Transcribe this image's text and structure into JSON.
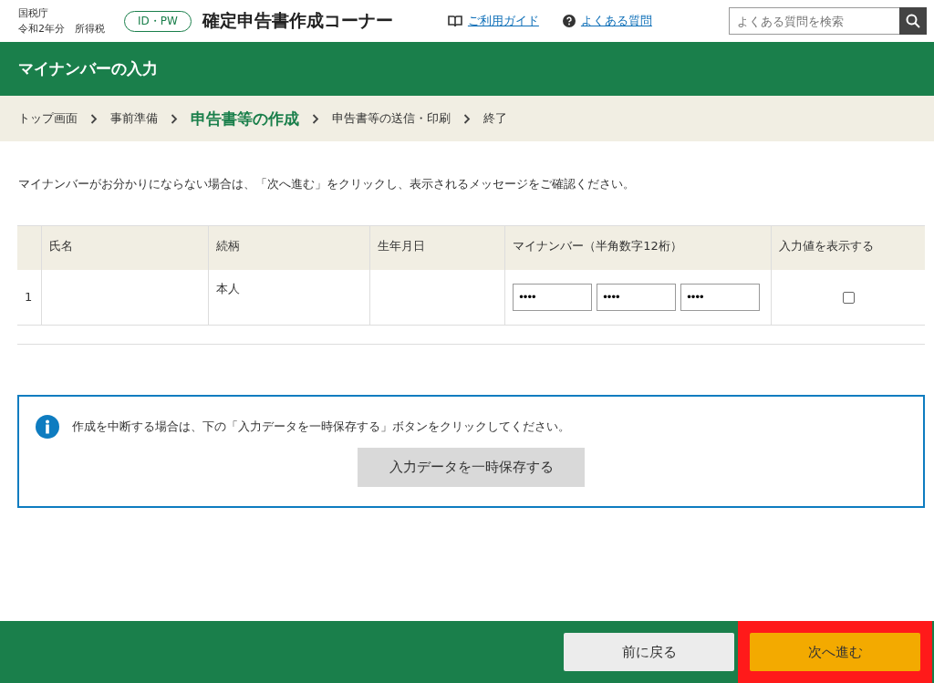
{
  "header": {
    "agency": "国税庁",
    "year_line": "令和2年分　所得税",
    "login_badge": "ID・PW",
    "site_title": "確定申告書作成コーナー",
    "links": [
      {
        "label": "ご利用ガイド",
        "kind": "guide"
      },
      {
        "label": "よくある質問",
        "kind": "faq"
      }
    ],
    "search": {
      "placeholder": "よくある質問を検索"
    }
  },
  "page_title": "マイナンバーの入力",
  "breadcrumb": [
    {
      "label": "トップ画面",
      "selected": false
    },
    {
      "label": "事前準備",
      "selected": false
    },
    {
      "label": "申告書等の作成",
      "selected": true
    },
    {
      "label": "申告書等の送信・印刷",
      "selected": false
    },
    {
      "label": "終了",
      "selected": false
    }
  ],
  "notice": "マイナンバーがお分かりにならない場合は、「次へ進む」をクリックし、表示されるメッセージをご確認ください。",
  "table": {
    "columns": [
      "氏名",
      "続柄",
      "生年月日",
      "マイナンバー（半角数字12桁）",
      "入力値を表示する"
    ],
    "rows": [
      {
        "index": "1",
        "name": "",
        "relation": "本人",
        "birthdate": "",
        "mynumber": [
          "••••",
          "••••",
          "••••"
        ],
        "show_value": false
      }
    ]
  },
  "info_box": {
    "message": "作成を中断する場合は、下の「入力データを一時保存する」ボタンをクリックしてください。",
    "button": "入力データを一時保存する"
  },
  "footer": {
    "buttons": [
      {
        "label": "前に戻る",
        "kind": "back",
        "highlighted": false
      },
      {
        "label": "次へ進む",
        "kind": "next",
        "highlighted": true
      }
    ]
  }
}
